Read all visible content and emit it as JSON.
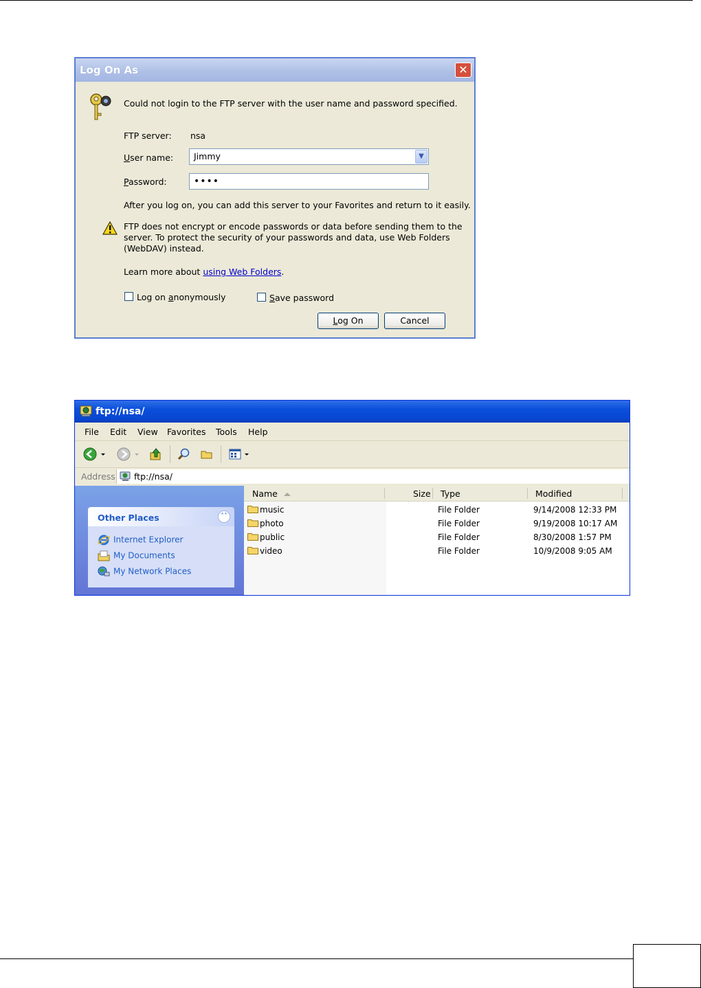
{
  "dialog": {
    "title": "Log On As",
    "message": "Could not login to the FTP server with the user name and password specified.",
    "ftp_server_label": "FTP server:",
    "ftp_server_value": "nsa",
    "username_label_prefix": "U",
    "username_label_rest": "ser name:",
    "username_value": "Jimmy",
    "password_label_prefix": "P",
    "password_label_rest": "assword:",
    "password_value": "••••",
    "favorites_note": "After you log on, you can add this server to your Favorites and return to it easily.",
    "warning_line1": "FTP does not encrypt or encode passwords or data before sending them to the",
    "warning_line2": "server.  To protect the security of your passwords and data, use Web Folders",
    "warning_line3": "(WebDAV) instead.",
    "learn_prefix": "Learn more about ",
    "learn_link": "using Web Folders",
    "learn_suffix": ".",
    "anon_prefix": "Log on ",
    "anon_u": "a",
    "anon_rest": "nonymously",
    "save_u": "S",
    "save_rest": "ave password",
    "logon_u": "L",
    "logon_rest": "og On",
    "cancel_label": "Cancel",
    "close_glyph": "✕"
  },
  "explorer": {
    "title": "ftp://nsa/",
    "menu": [
      "File",
      "Edit",
      "View",
      "Favorites",
      "Tools",
      "Help"
    ],
    "address_label": "Address",
    "address_value": "ftp://nsa/",
    "other_places_title": "Other Places",
    "other_places_toggle": "˄˄",
    "other_places": [
      "Internet Explorer",
      "My Documents",
      "My Network Places"
    ],
    "columns": {
      "name": "Name",
      "size": "Size",
      "type": "Type",
      "modified": "Modified"
    },
    "rows": [
      {
        "name": "music",
        "type": "File Folder",
        "modified": "9/14/2008 12:33 PM"
      },
      {
        "name": "photo",
        "type": "File Folder",
        "modified": "9/19/2008 10:17 AM"
      },
      {
        "name": "public",
        "type": "File Folder",
        "modified": "8/30/2008 1:57 PM"
      },
      {
        "name": "video",
        "type": "File Folder",
        "modified": "10/9/2008 9:05 AM"
      }
    ]
  },
  "colors": {
    "xp_blue": "#0a4fdb",
    "dialog_bg": "#ece9d8",
    "link": "#215dc6"
  }
}
